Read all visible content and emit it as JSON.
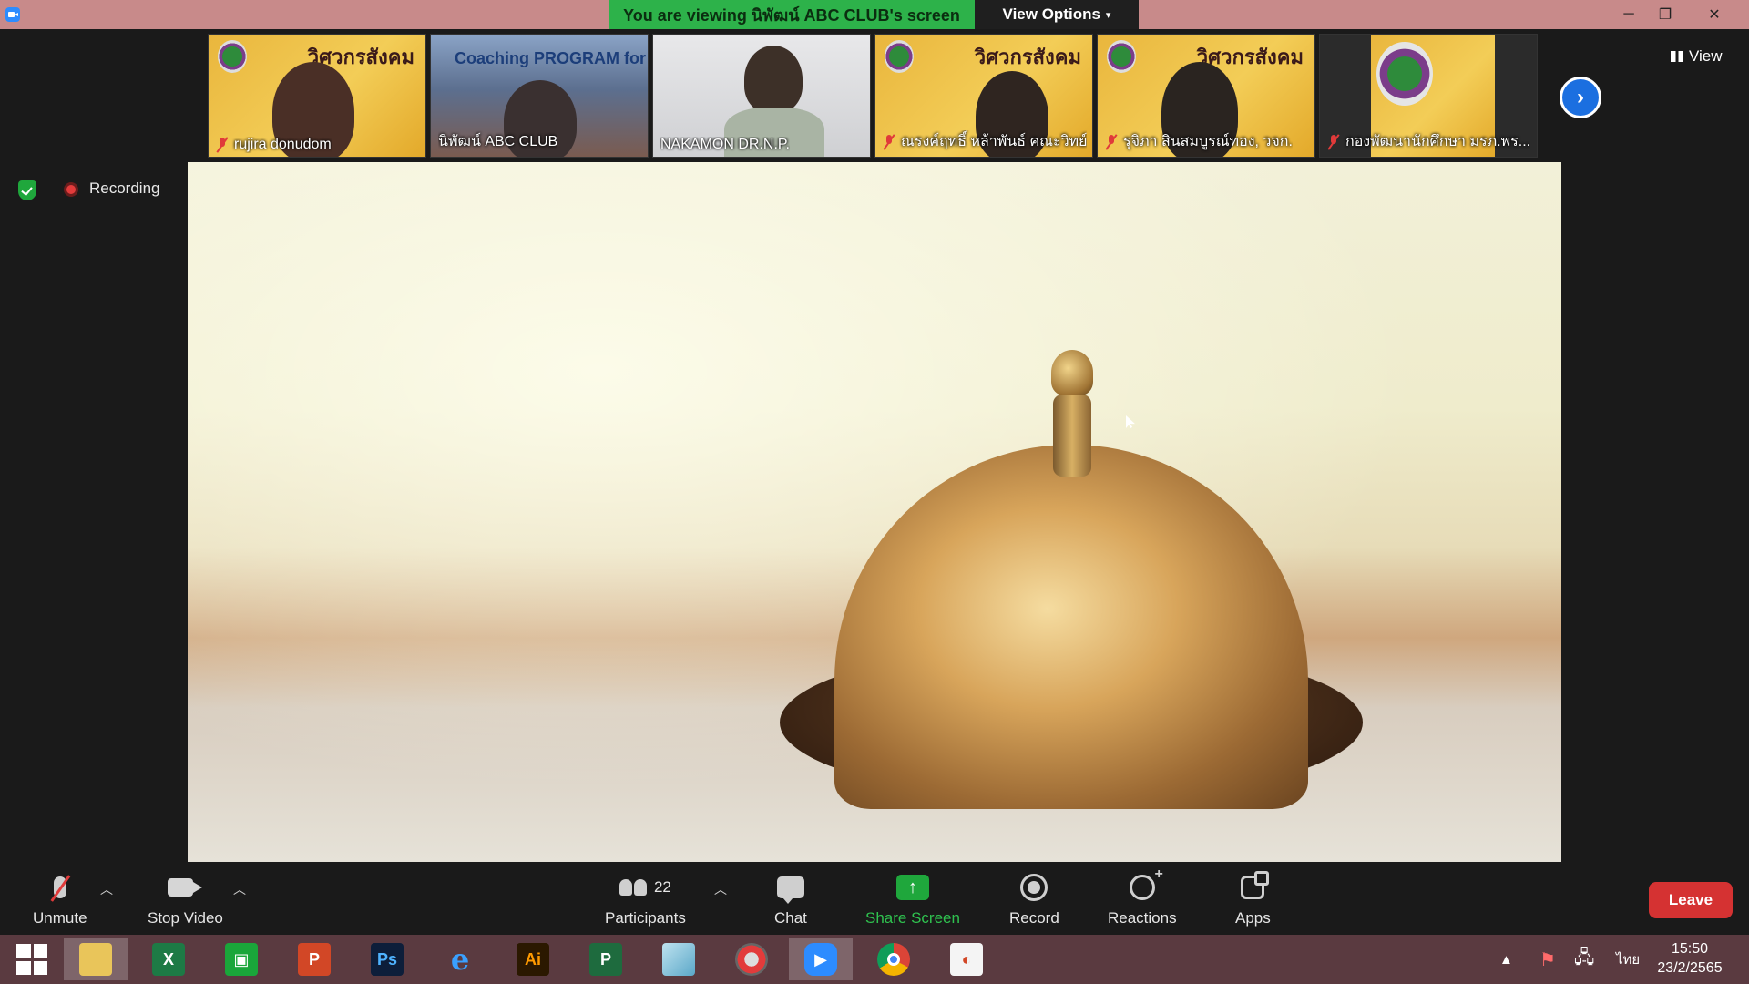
{
  "titlebar": {
    "banner_text": "You are viewing นิพัฒน์ ABC CLUB's screen",
    "view_options_label": "View Options",
    "window_controls": [
      "minimize-icon",
      "restore-icon",
      "close-icon"
    ]
  },
  "participants_strip": [
    {
      "name": "rujira donudom",
      "muted": true
    },
    {
      "name": "นิพัฒน์ ABC CLUB",
      "muted": false,
      "screen_text": "Coaching PROGRAM for Lecturer"
    },
    {
      "name": "NAKAMON DR.N.P.",
      "muted": false
    },
    {
      "name": "ณรงค์ฤทธิ์ หล้าพันธ์ คณะวิทย์",
      "muted": true
    },
    {
      "name": "รุจิภา สินสมบูรณ์ทอง, วจก.",
      "muted": true
    },
    {
      "name": "กองพัฒนานักศึกษา มรภ.พร...",
      "muted": true
    }
  ],
  "strip_overlay_text": "วิศวกรสังคม",
  "view_button_label": "View",
  "status": {
    "recording_label": "Recording"
  },
  "toolbar": {
    "unmute_label": "Unmute",
    "stop_video_label": "Stop Video",
    "participants_label": "Participants",
    "participants_count": "22",
    "chat_label": "Chat",
    "share_screen_label": "Share Screen",
    "record_label": "Record",
    "reactions_label": "Reactions",
    "apps_label": "Apps",
    "leave_label": "Leave"
  },
  "taskbar": {
    "apps": [
      "windows-start",
      "file-explorer",
      "excel",
      "publisher-store",
      "powerpoint",
      "photoshop",
      "internet-explorer",
      "illustrator",
      "project",
      "notepad-pen",
      "photoscape",
      "zoom",
      "chrome",
      "office-other"
    ],
    "app_glyphs": {
      "excel": "X",
      "powerpoint": "P",
      "photoshop": "Ps",
      "illustrator": "Ai",
      "project": "P"
    },
    "lang": "ไทย",
    "time": "15:50",
    "date": "23/2/2565"
  },
  "colors": {
    "banner_green": "#2db24a",
    "leave_red": "#d53232",
    "share_green": "#1fa73c",
    "next_blue": "#1b6fe0",
    "titlebar_pink": "#c88a8a",
    "taskbar": "#5a3a40"
  }
}
